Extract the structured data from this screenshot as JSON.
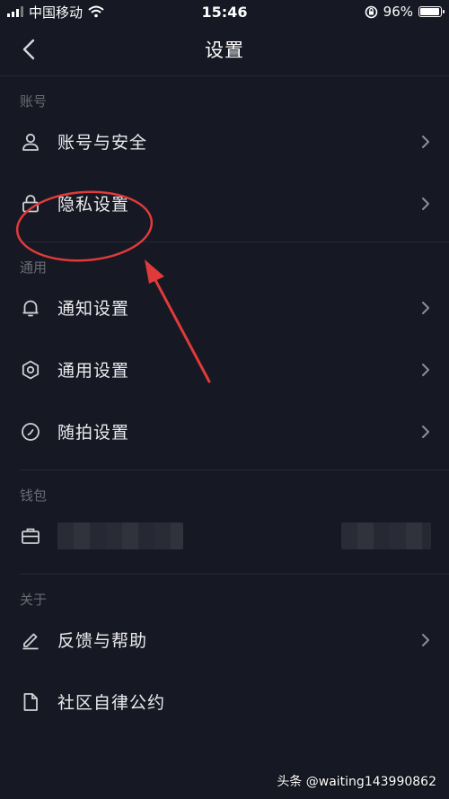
{
  "status_bar": {
    "carrier": "中国移动",
    "time": "15:46",
    "battery": "96%",
    "battery_level": 0.96
  },
  "nav": {
    "title": "设置"
  },
  "sections": {
    "account": {
      "label": "账号",
      "items": [
        {
          "label": "账号与安全",
          "icon": "person-icon"
        },
        {
          "label": "隐私设置",
          "icon": "lock-icon"
        }
      ]
    },
    "general": {
      "label": "通用",
      "items": [
        {
          "label": "通知设置",
          "icon": "bell-icon"
        },
        {
          "label": "通用设置",
          "icon": "gear-icon"
        },
        {
          "label": "随拍设置",
          "icon": "clock-icon"
        }
      ]
    },
    "wallet": {
      "label": "钱包",
      "icon": "wallet-icon"
    },
    "about": {
      "label": "关于",
      "items": [
        {
          "label": "反馈与帮助",
          "icon": "edit-icon"
        },
        {
          "label": "社区自律公约",
          "icon": "document-icon"
        }
      ]
    }
  },
  "colors": {
    "background": "#161823",
    "annotation": "#e03a3a"
  },
  "watermark": "头条 @waiting143990862"
}
